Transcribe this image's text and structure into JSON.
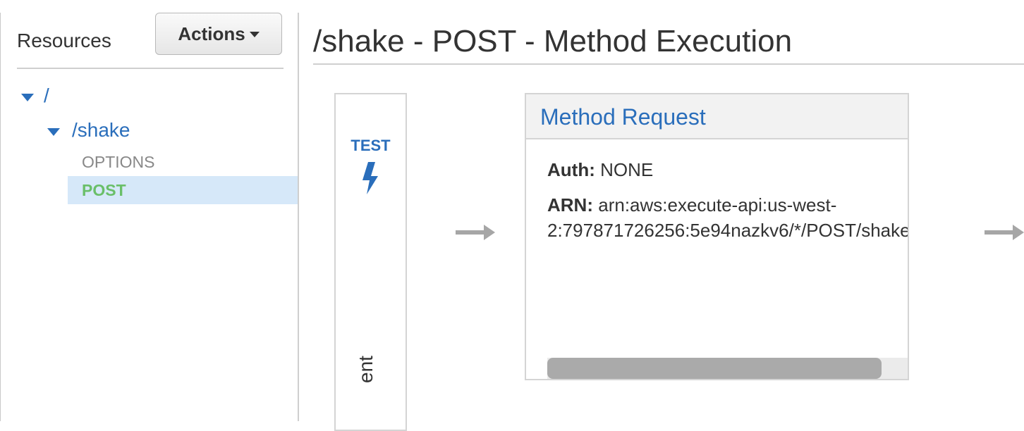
{
  "sidebar": {
    "title": "Resources",
    "actions_label": "Actions",
    "tree": {
      "root": "/",
      "resource": "/shake",
      "methods": [
        {
          "label": "OPTIONS",
          "color": "#888888"
        },
        {
          "label": "POST",
          "color": "#6abf69",
          "selected": true
        }
      ]
    }
  },
  "main": {
    "title": "/shake - POST - Method Execution",
    "test": {
      "label": "TEST",
      "icon": "lightning-bolt-icon"
    },
    "client_label": "ent",
    "method_request": {
      "title": "Method Request",
      "auth_key": "Auth:",
      "auth_value": "NONE",
      "arn_key": "ARN:",
      "arn_line1": "arn:aws:execute-api:us-west-",
      "arn_line2": "2:797871726256:5e94nazkv6/*/POST/shake"
    }
  },
  "colors": {
    "link": "#2a6ebb",
    "selected_row": "#d6e8f9",
    "post_method": "#6abf69",
    "arrow": "#a6a6a6"
  }
}
